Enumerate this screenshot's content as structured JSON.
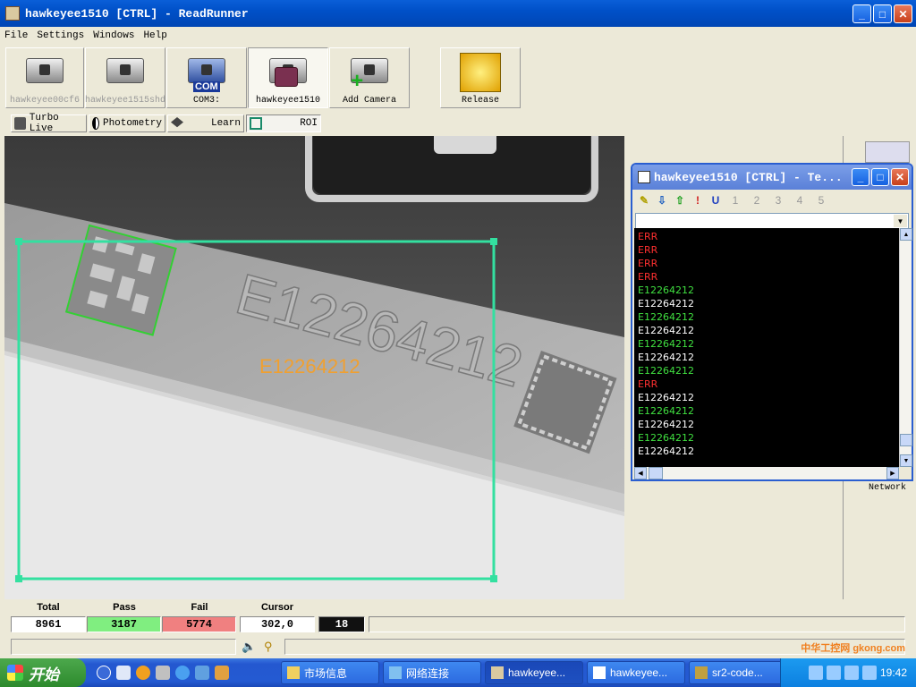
{
  "app": {
    "title": "hawkeyee1510 [CTRL] - ReadRunner",
    "window_controls": {
      "minimize": "_",
      "maximize": "□",
      "close": "✕"
    }
  },
  "menu": [
    "File",
    "Settings",
    "Windows",
    "Help"
  ],
  "toolbar": {
    "buttons": [
      {
        "label": "hawkeyee00cf6",
        "icon": "camera-icon",
        "state": "disabled"
      },
      {
        "label": "hawkeyee1515shd",
        "icon": "camera-icon",
        "state": "disabled"
      },
      {
        "label": "COM3:",
        "icon": "com-port-icon",
        "state": "normal",
        "badge": "COM"
      },
      {
        "label": "hawkeyee1510",
        "icon": "locked-camera-icon",
        "state": "active"
      },
      {
        "label": "Add Camera",
        "icon": "add-camera-icon",
        "state": "normal"
      },
      {
        "label": "Release",
        "icon": "release-hand-icon",
        "state": "normal"
      }
    ]
  },
  "subtoolbar": [
    {
      "label": "Turbo Live",
      "icon": "turbo-live-icon"
    },
    {
      "label": "Photometry",
      "icon": "photometry-icon"
    },
    {
      "label": "Learn",
      "icon": "learn-icon"
    },
    {
      "label": "ROI",
      "icon": "roi-icon",
      "active": true
    }
  ],
  "image": {
    "decoded_text": "E12264212",
    "roi_color": "#33e0a0",
    "symbol_box_color": "#33d033"
  },
  "terminal": {
    "title": "hawkeyee1510 [CTRL] - Te...",
    "tools": [
      "1",
      "2",
      "3",
      "4",
      "5"
    ],
    "log": [
      {
        "text": "ERR",
        "color": "#ff3030"
      },
      {
        "text": "ERR",
        "color": "#ff3030"
      },
      {
        "text": "ERR",
        "color": "#ff3030"
      },
      {
        "text": "ERR",
        "color": "#ff3030"
      },
      {
        "text": "E12264212",
        "color": "#40e040"
      },
      {
        "text": "E12264212",
        "color": "#ffffff"
      },
      {
        "text": "E12264212",
        "color": "#40e040"
      },
      {
        "text": "E12264212",
        "color": "#ffffff"
      },
      {
        "text": "E12264212",
        "color": "#40e040"
      },
      {
        "text": "E12264212",
        "color": "#ffffff"
      },
      {
        "text": "E12264212",
        "color": "#40e040"
      },
      {
        "text": "ERR",
        "color": "#ff3030"
      },
      {
        "text": "E12264212",
        "color": "#ffffff"
      },
      {
        "text": "E12264212",
        "color": "#40e040"
      },
      {
        "text": "E12264212",
        "color": "#ffffff"
      },
      {
        "text": "E12264212",
        "color": "#40e040"
      },
      {
        "text": "E12264212",
        "color": "#ffffff"
      }
    ]
  },
  "side": {
    "network_label": "Network"
  },
  "stats": {
    "total_label": "Total",
    "total": "8961",
    "pass_label": "Pass",
    "pass": "3187",
    "fail_label": "Fail",
    "fail": "5774",
    "cursor_label": "Cursor",
    "cursor": "302,0",
    "value": "18"
  },
  "taskbar": {
    "start": "开始",
    "tasks": [
      "市场信息",
      "网络连接",
      "hawkeyee...",
      "hawkeyee...",
      "sr2-code..."
    ],
    "clock": "19:42",
    "watermark": "中华工控网 gkong.com"
  }
}
